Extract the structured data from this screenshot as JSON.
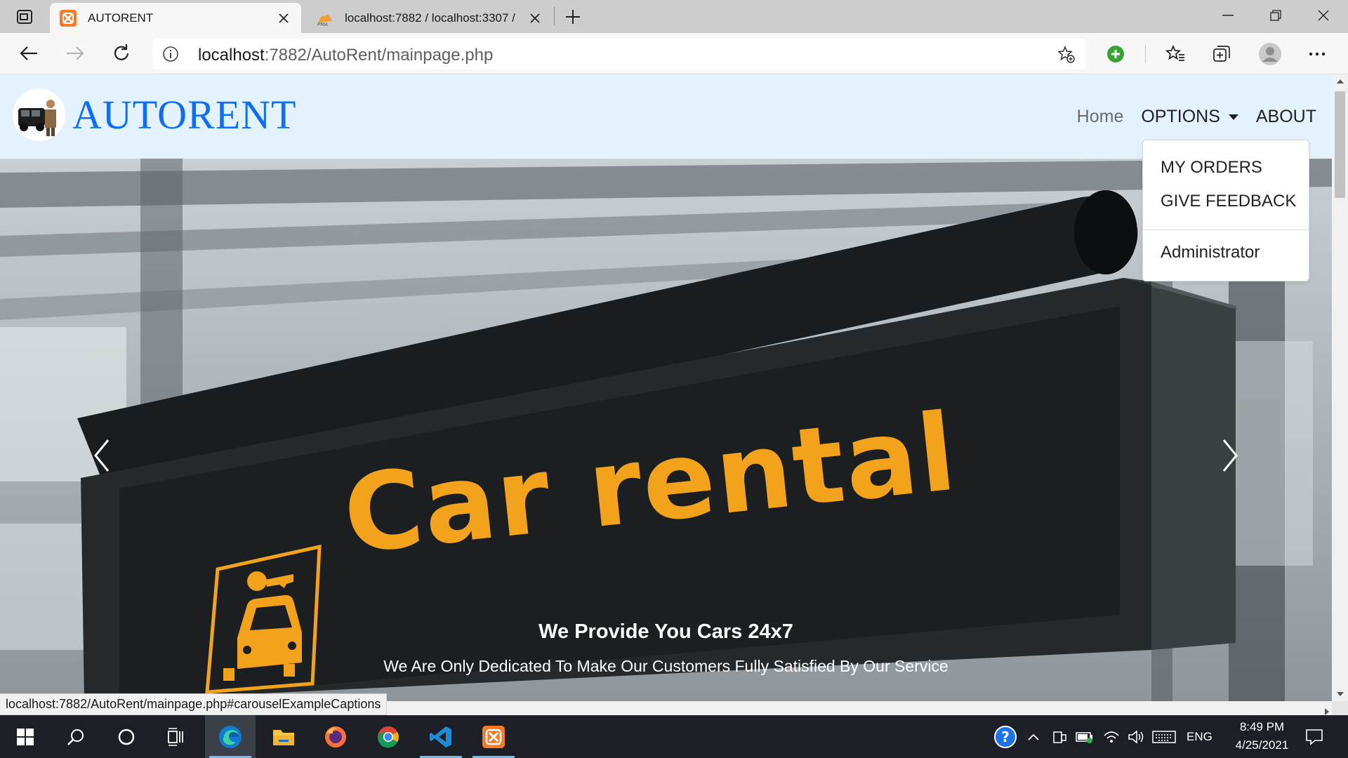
{
  "browser": {
    "tabs": [
      {
        "title": "AUTORENT",
        "favicon": "xampp-icon",
        "active": true
      },
      {
        "title": "localhost:7882 / localhost:3307 /",
        "favicon": "phpmyadmin-icon",
        "active": false
      }
    ],
    "address": {
      "host": "localhost",
      "path": ":7882/AutoRent/mainpage.php"
    },
    "status_url": "localhost:7882/AutoRent/mainpage.php#carouselExampleCaptions"
  },
  "site": {
    "brand": "AUTORENT",
    "nav": {
      "home": "Home",
      "options": "OPTIONS",
      "about": "ABOUT"
    },
    "dropdown": {
      "items": [
        "MY ORDERS",
        "GIVE FEEDBACK"
      ],
      "admin": "Administrator"
    },
    "carousel": {
      "sign_text": "Car rental",
      "caption_title": "We Provide You Cars 24x7",
      "caption_text": "We Are Only Dedicated To Make Our Customers Fully Satisfied By Our Service"
    }
  },
  "taskbar": {
    "apps": [
      "windows-start-icon",
      "search-icon",
      "cortana-icon",
      "task-view-icon",
      "edge-icon",
      "file-explorer-icon",
      "firefox-icon",
      "chrome-icon",
      "vscode-icon",
      "xampp-icon"
    ],
    "language": "ENG",
    "time": "8:49 PM",
    "date": "4/25/2021"
  },
  "colors": {
    "brand_blue": "#0d6efd",
    "navbar_bg": "#e3f2fd",
    "sign_yellow": "#f2a21b",
    "taskbar_bg": "#1c1f26"
  }
}
